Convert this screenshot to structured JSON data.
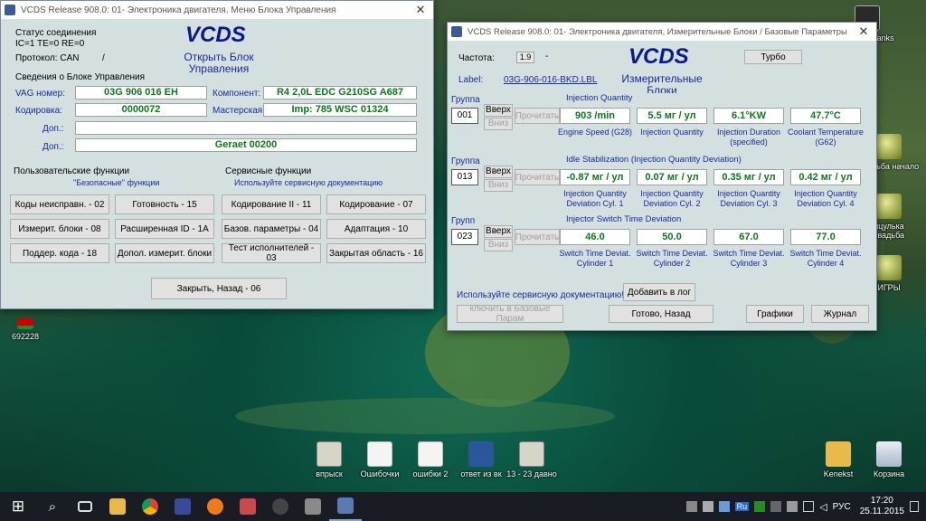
{
  "desktop": {
    "left_icons": [
      {
        "label": "692228"
      }
    ],
    "right_icons": [
      {
        "label": "World of Tanks"
      },
      {
        "label": "свадьба начало"
      },
      {
        "label": "нцулька свадьба"
      },
      {
        "label": "ИГРЫ"
      }
    ],
    "bottom_icons": [
      {
        "label": "впрыск"
      },
      {
        "label": "Ошибочки"
      },
      {
        "label": "ошибки 2"
      },
      {
        "label": "ответ из вк"
      },
      {
        "label": "13 - 23 давно"
      },
      {
        "label": "Kenekst"
      },
      {
        "label": "Корзина"
      }
    ]
  },
  "taskbar": {
    "start_glyph": "⊞",
    "search_glyph": "⌕",
    "lang": "РУС",
    "time": "17:20",
    "date": "25.11.2015",
    "tray_ru": "Ru"
  },
  "win_left": {
    "title": "VCDS Release 908.0: 01- Электроника двигателя,  Меню Блока Управления",
    "close": "✕",
    "status_title": "Статус соединения",
    "status_line": "IC=1  TE=0   RE=0",
    "protocol": "Протокол: CAN",
    "protocol_sep": "/",
    "logo": "VCDS",
    "header_line1": "Открыть Блок",
    "header_line2": "Управления",
    "ecu_info": "Сведения о Блоке Управления",
    "vag_label": "VAG номер:",
    "vag_value": "03G 906 016 EH",
    "component_label": "Компонент:",
    "component_value": "R4 2,0L EDC G210SG  A687",
    "coding_label": "Кодировка:",
    "coding_value": "0000072",
    "workshop_label": "Мастерская:",
    "workshop_value": "Imp: 785     WSC 01324",
    "extra1_label": "Доп.:",
    "extra1_value": "",
    "extra2_label": "Доп.:",
    "extra2_value": "Geraet 00200",
    "user_funcs": "Пользовательские функции",
    "user_funcs_sub": "\"Безопасные\" функции",
    "service_funcs": "Сервисные функции",
    "service_funcs_sub": "Используйте сервисную документацию",
    "buttons": [
      "Коды неисправн. - 02",
      "Готовность - 15",
      "Кодирование II - 11",
      "Кодирование - 07",
      "Измерит. блоки - 08",
      "Расширенная ID - 1A",
      "Базов. параметры - 04",
      "Адаптация - 10",
      "Поддер. кода - 18",
      "Допол. измерит. блоки",
      "Тест исполнителей - 03",
      "Закрытая область - 16"
    ],
    "close_button": "Закрыть, Назад - 06"
  },
  "win_right": {
    "title": "VCDS Release 908.0: 01- Электроника двигателя,  Измерительные Блоки / Базовые Параметры",
    "close": "✕",
    "freq_label": "Частота:",
    "freq_value": "1.9",
    "freq_dash": "-",
    "turbo": "Турбо",
    "label_label": "Label:",
    "label_link": "03G-906-016-BKD.LBL",
    "logo": "VCDS",
    "header_line1": "Измерительные",
    "header_line2": "Блоки",
    "up": "Вверх",
    "down": "Вниз",
    "read": "Прочитать",
    "groups": [
      {
        "group_label": "Группа",
        "number": "001",
        "title": "Injection Quantity",
        "values": [
          "903 /min",
          "5.5 мг / ул",
          "6.1°KW",
          "47.7°C"
        ],
        "labels": [
          "Engine Speed (G28)",
          "Injection Quantity",
          "Injection Duration (specified)",
          "Coolant Temperature (G62)"
        ]
      },
      {
        "group_label": "Группа",
        "number": "013",
        "title": "Idle Stabilization (Injection Quantity Deviation)",
        "values": [
          "-0.87 мг / ул",
          "0.07 мг / ул",
          "0.35 мг / ул",
          "0.42 мг / ул"
        ],
        "labels": [
          "Injection Quantity Deviation Cyl. 1",
          "Injection Quantity Deviation Cyl. 2",
          "Injection Quantity Deviation Cyl. 3",
          "Injection Quantity Deviation Cyl. 4"
        ]
      },
      {
        "group_label": "Групп",
        "number": "023",
        "title": "Injector Switch Time Deviation",
        "values": [
          "46.0",
          "50.0",
          "67.0",
          "77.0"
        ],
        "labels": [
          "Switch Time Deviat. Cylinder 1",
          "Switch Time Deviat. Cylinder 2",
          "Switch Time Deviat. Cylinder 3",
          "Switch Time Deviat. Cylinder 4"
        ]
      }
    ],
    "service_note": "Используйте сервисную документацию!",
    "add_log": "Добавить в лог",
    "switch_basic": "ключить в Базовые Парам",
    "done": "Готово, Назад",
    "graphs": "Графики",
    "journal": "Журнал"
  }
}
